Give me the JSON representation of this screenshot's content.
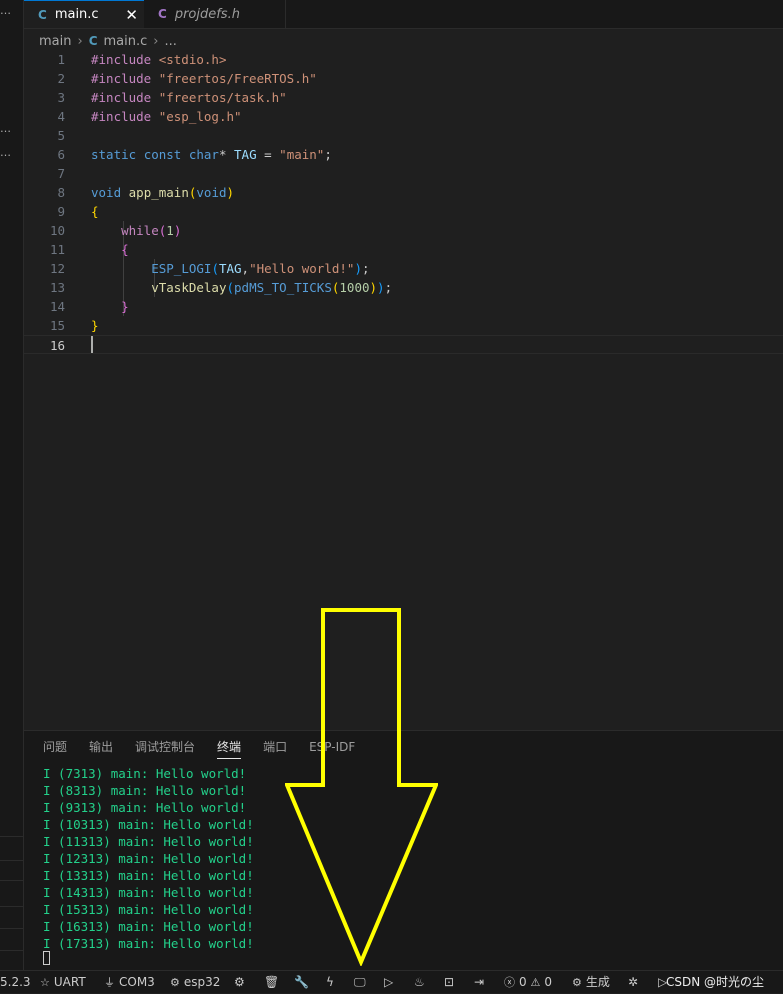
{
  "tabs": [
    {
      "icon": "C",
      "label": "main.c",
      "close": "✕"
    },
    {
      "icon": "C",
      "label": "projdefs.h"
    }
  ],
  "breadcrumb": {
    "folder": "main",
    "icon": "C",
    "file": "main.c",
    "more": "..."
  },
  "sidebar": {
    "fragment1": "…",
    "fragment2": "…",
    "fragment3": "…",
    "version": "5.2.3"
  },
  "editor": {
    "line_numbers": [
      "1",
      "2",
      "3",
      "4",
      "5",
      "6",
      "7",
      "8",
      "9",
      "10",
      "11",
      "12",
      "13",
      "14",
      "15",
      "16"
    ],
    "lines": [
      [
        {
          "t": "#include ",
          "c": "kw2"
        },
        {
          "t": "<stdio.h>",
          "c": "str"
        }
      ],
      [
        {
          "t": "#include ",
          "c": "kw2"
        },
        {
          "t": "\"freertos/FreeRTOS.h\"",
          "c": "str"
        }
      ],
      [
        {
          "t": "#include ",
          "c": "kw2"
        },
        {
          "t": "\"freertos/task.h\"",
          "c": "str"
        }
      ],
      [
        {
          "t": "#include ",
          "c": "kw2"
        },
        {
          "t": "\"esp_log.h\"",
          "c": "str"
        }
      ],
      [],
      [
        {
          "t": "static ",
          "c": "kw"
        },
        {
          "t": "const ",
          "c": "kw"
        },
        {
          "t": "char",
          "c": "kw"
        },
        {
          "t": "* ",
          "c": "txt"
        },
        {
          "t": "TAG",
          "c": "var"
        },
        {
          "t": " = ",
          "c": "txt"
        },
        {
          "t": "\"main\"",
          "c": "str"
        },
        {
          "t": ";",
          "c": "txt"
        }
      ],
      [],
      [
        {
          "t": "void ",
          "c": "kw"
        },
        {
          "t": "app_main",
          "c": "fn"
        },
        {
          "t": "(",
          "c": "br1"
        },
        {
          "t": "void",
          "c": "kw"
        },
        {
          "t": ")",
          "c": "br1"
        }
      ],
      [
        {
          "t": "{",
          "c": "br1"
        }
      ],
      [
        {
          "t": "    ",
          "c": "txt"
        },
        {
          "t": "while",
          "c": "ctl"
        },
        {
          "t": "(",
          "c": "br2"
        },
        {
          "t": "1",
          "c": "num"
        },
        {
          "t": ")",
          "c": "br2"
        }
      ],
      [
        {
          "t": "    ",
          "c": "txt"
        },
        {
          "t": "{",
          "c": "br2"
        }
      ],
      [
        {
          "t": "        ",
          "c": "txt"
        },
        {
          "t": "ESP_LOGI",
          "c": "macro"
        },
        {
          "t": "(",
          "c": "br3"
        },
        {
          "t": "TAG",
          "c": "var"
        },
        {
          "t": ",",
          "c": "txt"
        },
        {
          "t": "\"Hello world!\"",
          "c": "str"
        },
        {
          "t": ")",
          "c": "br3"
        },
        {
          "t": ";",
          "c": "txt"
        }
      ],
      [
        {
          "t": "        ",
          "c": "txt"
        },
        {
          "t": "vTaskDelay",
          "c": "fn"
        },
        {
          "t": "(",
          "c": "br3"
        },
        {
          "t": "pdMS_TO_TICKS",
          "c": "macro"
        },
        {
          "t": "(",
          "c": "br1"
        },
        {
          "t": "1000",
          "c": "num"
        },
        {
          "t": ")",
          "c": "br1"
        },
        {
          "t": ")",
          "c": "br3"
        },
        {
          "t": ";",
          "c": "txt"
        }
      ],
      [
        {
          "t": "    ",
          "c": "txt"
        },
        {
          "t": "}",
          "c": "br2"
        }
      ],
      [
        {
          "t": "}",
          "c": "br1"
        }
      ],
      []
    ],
    "current_line": 16
  },
  "syntax_colors": {
    "kw": "#569cd6",
    "kw2": "#c586c0",
    "ctl": "#c586c0",
    "str": "#ce9178",
    "fn": "#dcdcaa",
    "macro": "#569cd6",
    "var": "#9cdcfe",
    "num": "#b5cea8",
    "txt": "#cccccc",
    "br1": "#ffd700",
    "br2": "#da70d6",
    "br3": "#179fff"
  },
  "panel": {
    "tabs": [
      "问题",
      "输出",
      "调试控制台",
      "终端",
      "端口",
      "ESP-IDF"
    ],
    "active_tab": "终端",
    "terminal_lines": [
      "I (7313) main: Hello world!",
      "I (8313) main: Hello world!",
      "I (9313) main: Hello world!",
      "I (10313) main: Hello world!",
      "I (11313) main: Hello world!",
      "I (12313) main: Hello world!",
      "I (13313) main: Hello world!",
      "I (14313) main: Hello world!",
      "I (15313) main: Hello world!",
      "I (16313) main: Hello world!",
      "I (17313) main: Hello world!"
    ]
  },
  "statusbar": {
    "uart": "UART",
    "com": "COM3",
    "target": "esp32",
    "errors": "0",
    "warnings": "0",
    "build": "生成",
    "watermark": "CSDN @时光の尘"
  },
  "annotation_color": "#ffff00"
}
